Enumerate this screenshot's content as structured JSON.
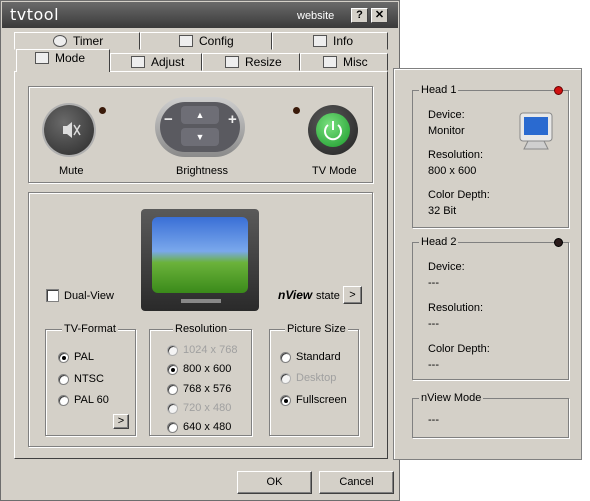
{
  "window": {
    "title": "tvtool",
    "website_label": "website",
    "help_button": "?",
    "close_button": "✕"
  },
  "tabs_row1": [
    {
      "label": "Timer",
      "icon": "clock-icon"
    },
    {
      "label": "Config",
      "icon": "wrench-icon"
    },
    {
      "label": "Info",
      "icon": "info-icon"
    }
  ],
  "tabs_row2": [
    {
      "label": "Mode",
      "icon": "monitor-icon",
      "active": true
    },
    {
      "label": "Adjust",
      "icon": "adjust-icon"
    },
    {
      "label": "Resize",
      "icon": "resize-icon"
    },
    {
      "label": "Misc",
      "icon": "speaker-icon"
    }
  ],
  "controls": {
    "mute_label": "Mute",
    "brightness_label": "Brightness",
    "tvmode_label": "TV Mode",
    "brightness_minus": "−",
    "brightness_plus": "+",
    "brightness_up": "▲",
    "brightness_down": "▼"
  },
  "display": {
    "dualview_label": "Dual-View",
    "dualview_checked": false,
    "nview_label": "nView",
    "nview_state_label": "state",
    "nview_button": ">"
  },
  "tv_format": {
    "title": "TV-Format",
    "options": [
      {
        "label": "PAL",
        "selected": true,
        "enabled": true
      },
      {
        "label": "NTSC",
        "selected": false,
        "enabled": true
      },
      {
        "label": "PAL 60",
        "selected": false,
        "enabled": true
      }
    ],
    "more_button": ">"
  },
  "resolution": {
    "title": "Resolution",
    "options": [
      {
        "label": "1024 x 768",
        "selected": false,
        "enabled": false
      },
      {
        "label": "800 x 600",
        "selected": true,
        "enabled": true
      },
      {
        "label": "768 x 576",
        "selected": false,
        "enabled": true
      },
      {
        "label": "720 x 480",
        "selected": false,
        "enabled": false
      },
      {
        "label": "640 x 480",
        "selected": false,
        "enabled": true
      }
    ]
  },
  "picture_size": {
    "title": "Picture Size",
    "options": [
      {
        "label": "Standard",
        "selected": false,
        "enabled": true
      },
      {
        "label": "Desktop",
        "selected": false,
        "enabled": false
      },
      {
        "label": "Fullscreen",
        "selected": true,
        "enabled": true
      }
    ]
  },
  "buttons": {
    "ok": "OK",
    "cancel": "Cancel"
  },
  "head1": {
    "title": "Head 1",
    "device_label": "Device:",
    "device_value": "Monitor",
    "resolution_label": "Resolution:",
    "resolution_value": "800 x 600",
    "depth_label": "Color Depth:",
    "depth_value": "32 Bit",
    "led_color": "#d01010"
  },
  "head2": {
    "title": "Head 2",
    "device_label": "Device:",
    "device_value": "---",
    "resolution_label": "Resolution:",
    "resolution_value": "---",
    "depth_label": "Color Depth:",
    "depth_value": "---",
    "led_color": "#2a1a1a"
  },
  "nview_mode": {
    "title": "nView Mode",
    "value": "---"
  },
  "colors": {
    "tvmode_green": "#22b83a",
    "titlebar": "#4a4a4a",
    "face": "#d4d0c8"
  }
}
